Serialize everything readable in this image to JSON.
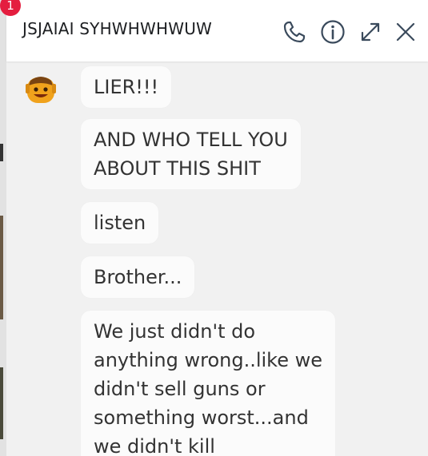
{
  "header": {
    "contact_name": "JSJAIAI SYHWHWHWUW",
    "badge_count": "1",
    "icons": [
      "phone-icon",
      "info-icon",
      "expand-icon",
      "close-icon"
    ]
  },
  "messages": [
    {
      "text": "LIER!!!"
    },
    {
      "text": "AND WHO TELL YOU\nABOUT THIS SHIT"
    },
    {
      "text": "listen"
    },
    {
      "text": "Brother..."
    },
    {
      "text": "We just didn't do\nanything wrong..like we\ndidn't sell guns or\nsomething worst...and\nwe didn't kill"
    }
  ],
  "colors": {
    "badge": "#e41e3f",
    "icon": "#3a4a5c",
    "chat_background": "#f1f1f1",
    "bubble": "#fbfbfb"
  }
}
